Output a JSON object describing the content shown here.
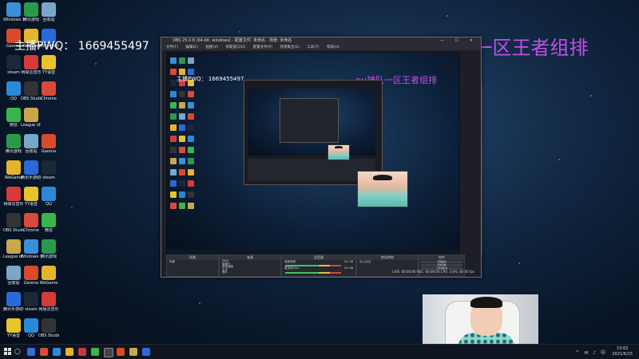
{
  "overlay": {
    "streamer_id": "主播PWQ：  1669455497",
    "team_text": "pu神队一区王者组排"
  },
  "colors": {
    "team_text": "#c050e6",
    "desktop_bg": "#112742",
    "obs_bg": "#1e1f26"
  },
  "obs_window": {
    "title": "OBS 25.0.8 (64-bit, windows) - 配置文件: 未命名 - 场景: 未命名",
    "menu": [
      "文件(F)",
      "编辑(E)",
      "视图(V)",
      "停靠窗口(D)",
      "配置文件(P)",
      "场景集合(S)",
      "工具(T)",
      "帮助(H)"
    ],
    "window_buttons": "— ☐ ✕",
    "docks": {
      "scenes": "场景",
      "sources": "来源",
      "mixer": "混音器",
      "transitions": "转场特效",
      "controls": "控件"
    },
    "scene_items": [
      "场景"
    ],
    "source_items": [
      "PWQ",
      "摄像头",
      "游戏画面",
      "文字",
      "图片"
    ],
    "mixer_items": [
      "桌面音频",
      "麦克风/Aux"
    ],
    "mixer_levels": [
      "0.0 dB",
      "0.0 dB"
    ],
    "transition": "淡入淡出",
    "controls": [
      "开始推流",
      "开始录制",
      "工作室模式",
      "设置",
      "退出"
    ],
    "status": "LIVE: 00:00:00  REC: 00:00:00  CPU: 3.6%, 60.00 fps"
  },
  "desktop_icons": [
    {
      "label": "Windows 10 此电脑",
      "icon": "computer-icon",
      "color": "#3a8fd8"
    },
    {
      "label": "腾讯游戏",
      "icon": "game-icon",
      "color": "#2a9a4a"
    },
    {
      "label": "回收站",
      "icon": "recycle-bin-icon",
      "color": "#7aa6c8"
    },
    {
      "label": "Garena",
      "icon": "garena-icon",
      "color": "#d84a2a"
    },
    {
      "label": "WeGame",
      "icon": "wegame-icon",
      "color": "#e6b42a"
    },
    {
      "label": "腾讯手游助手",
      "icon": "phone-icon",
      "color": "#2a6ad8"
    },
    {
      "label": "steam",
      "icon": "steam-icon",
      "color": "#1b2838"
    },
    {
      "label": "网易云音乐",
      "icon": "music-icon",
      "color": "#d83a3a"
    },
    {
      "label": "YY语音",
      "icon": "yy-icon",
      "color": "#e6c42a"
    },
    {
      "label": "QQ",
      "icon": "qq-icon",
      "color": "#2a8ad8"
    },
    {
      "label": "OBS Studio",
      "icon": "obs-icon",
      "color": "#333333"
    },
    {
      "label": "Chrome",
      "icon": "chrome-icon",
      "color": "#d84a3a"
    },
    {
      "label": "微信",
      "icon": "wechat-icon",
      "color": "#3ab54a"
    },
    {
      "label": "League of Legends",
      "icon": "lol-icon",
      "color": "#c8a84a"
    }
  ],
  "taskbar": {
    "tray": "^ ✉ ♪ 中",
    "time": "13:02",
    "date": "2021/6/15"
  }
}
